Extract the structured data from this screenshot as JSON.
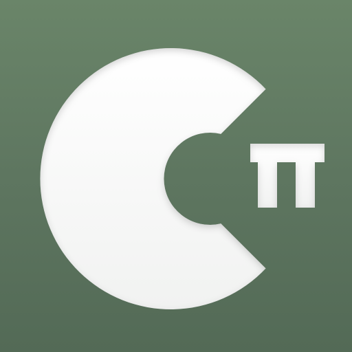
{
  "icon": {
    "name": "calculator-pi-logo",
    "glyphs": [
      "C",
      "π"
    ],
    "colors": {
      "background_top": "#6a8569",
      "background_bottom": "#536a56",
      "glyph_fill": "#ffffff",
      "inner_shadow": "#c9ccc9"
    }
  }
}
